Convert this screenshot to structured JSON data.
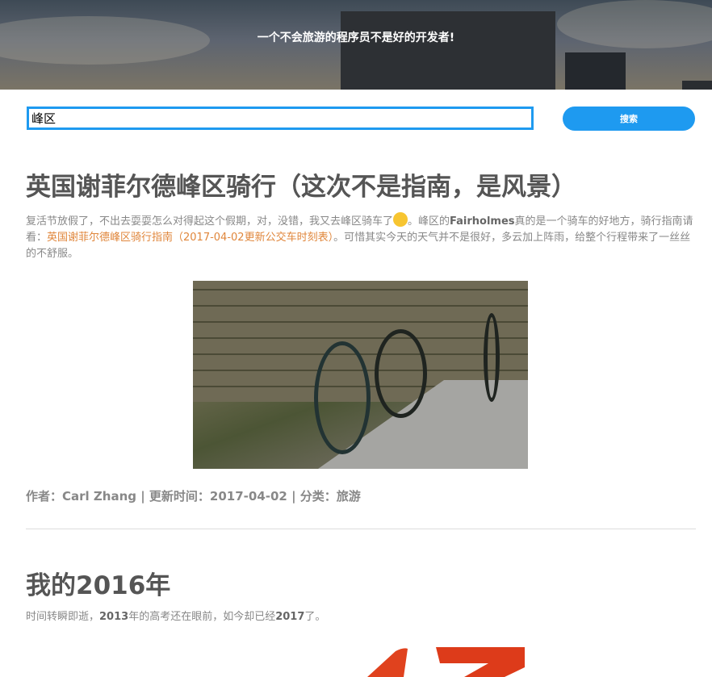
{
  "header": {
    "tagline": "一个不会旅游的程序员不是好的开发者!"
  },
  "search": {
    "value": "峰区",
    "button_label": "搜索"
  },
  "posts": [
    {
      "title": "英国谢菲尔德峰区骑行（这次不是指南，是风景）",
      "excerpt": {
        "part1": "复活节放假了，不出去耍耍怎么对得起这个假期，对，没错，我又去峰区骑车了",
        "emoji": "face-with-tears-of-joy",
        "part2": "。峰区的",
        "bold1": "Fairholmes",
        "part3": "真的是一个骑车的好地方，骑行指南请看：",
        "link": "英国谢菲尔德峰区骑行指南（2017-04-02更新公交车时刻表）",
        "part4": "。可惜其实今天的天气并不是很好，多云加上阵雨，给整个行程带来了一丝丝的不舒服。"
      },
      "meta": "作者：Carl Zhang | 更新时间：2017-04-02 | 分类：旅游"
    },
    {
      "title": "我的2016年",
      "excerpt": {
        "part1": "时间转瞬即逝，",
        "bold1": "2013",
        "part2": "年的高考还在眼前，如今却已经",
        "bold2": "2017",
        "part3": "了。"
      }
    }
  ],
  "colors": {
    "accent": "#1e9af0",
    "link": "#e0863b",
    "title": "#555555",
    "text": "#888888"
  }
}
